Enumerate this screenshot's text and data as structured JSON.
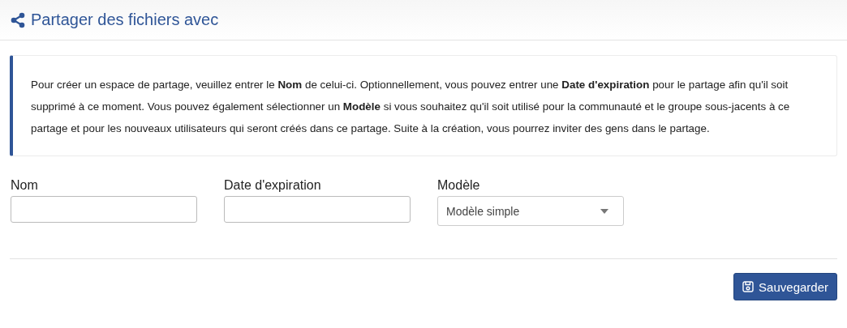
{
  "header": {
    "title": "Partager des fichiers avec"
  },
  "info": {
    "text": "Pour créer un espace de partage, veuillez entrer le **Nom** de celui-ci. Optionnellement, vous pouvez entrer une **Date d'expiration** pour le partage afin qu'il soit supprimé à ce moment. Vous pouvez également sélectionner un **Modèle** si vous souhaitez qu'il soit utilisé pour la communauté et le groupe sous-jacents à ce partage et pour les nouveaux utilisateurs qui seront créés dans ce partage. Suite à la création, vous pourrez inviter des gens dans le partage."
  },
  "fields": [
    {
      "kind": "text",
      "label": "Nom"
    },
    {
      "kind": "text",
      "label": "Date d'expiration"
    },
    {
      "kind": "select",
      "label": "Modèle",
      "value": "Modèle simple"
    }
  ],
  "save_button": {
    "label": "Sauvegarder"
  }
}
